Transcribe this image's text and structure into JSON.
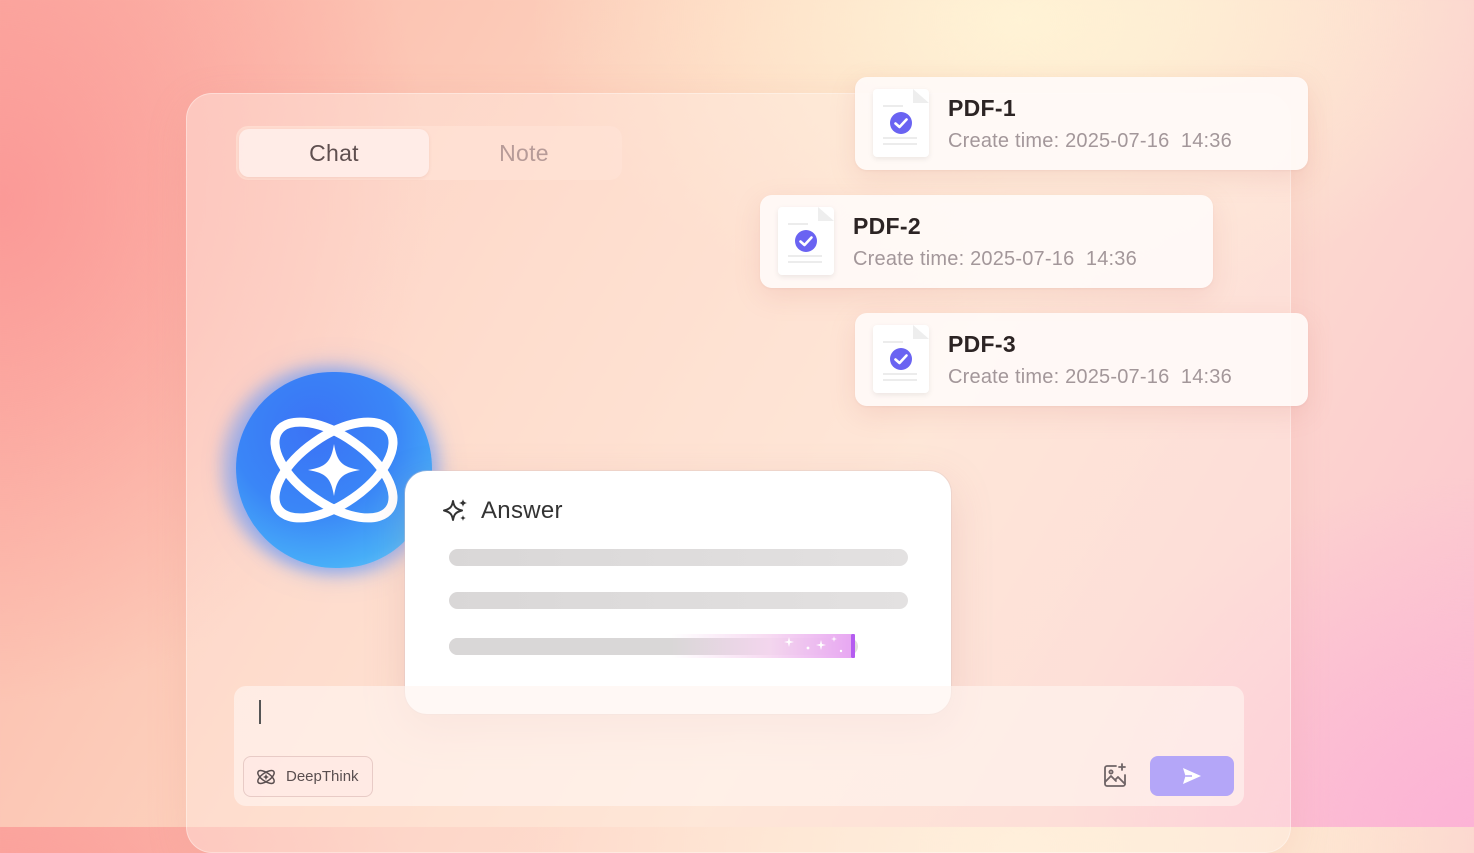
{
  "tabs": [
    {
      "label": "Chat",
      "active": true
    },
    {
      "label": "Note",
      "active": false
    }
  ],
  "documents": [
    {
      "title": "PDF-1",
      "time": "Create time: 2025-07-16  14:36",
      "checked": true
    },
    {
      "title": "PDF-2",
      "time": "Create time: 2025-07-16  14:36",
      "checked": true
    },
    {
      "title": "PDF-3",
      "time": "Create time: 2025-07-16  14:36",
      "checked": true
    }
  ],
  "answer": {
    "title": "Answer",
    "icon": "sparkle-icon",
    "progress_fraction": 0.99
  },
  "input": {
    "value": "",
    "deepthink_label": "DeepThink"
  },
  "colors": {
    "accent": "#b4a6f8",
    "check": "#6a63f2",
    "progress_highlight": "#b45cf0"
  },
  "icons": {
    "assistant_logo": "atom-star-logo",
    "deepthink": "atom-icon",
    "image_upload": "image-plus-icon",
    "send": "send-icon",
    "document": "document-check-icon"
  }
}
